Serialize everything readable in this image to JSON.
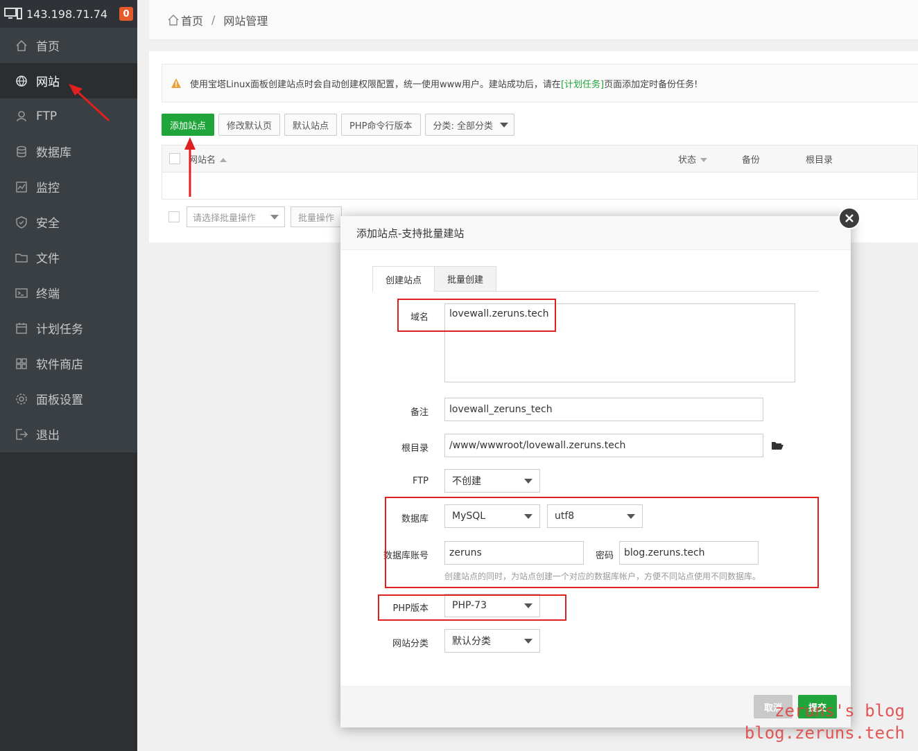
{
  "sidebar": {
    "server_ip": "143.198.71.74",
    "badge": "0",
    "items": [
      {
        "label": "首页",
        "icon": "home-icon"
      },
      {
        "label": "网站",
        "icon": "globe-icon"
      },
      {
        "label": "FTP",
        "icon": "ftp-icon"
      },
      {
        "label": "数据库",
        "icon": "database-icon"
      },
      {
        "label": "监控",
        "icon": "monitor-icon"
      },
      {
        "label": "安全",
        "icon": "shield-icon"
      },
      {
        "label": "文件",
        "icon": "folder-icon"
      },
      {
        "label": "终端",
        "icon": "terminal-icon"
      },
      {
        "label": "计划任务",
        "icon": "calendar-icon"
      },
      {
        "label": "软件商店",
        "icon": "apps-icon"
      },
      {
        "label": "面板设置",
        "icon": "gear-icon"
      },
      {
        "label": "退出",
        "icon": "logout-icon"
      }
    ],
    "active_index": 1
  },
  "breadcrumb": {
    "home": "首页",
    "sep": "/",
    "current": "网站管理"
  },
  "alert": {
    "text_before": "使用宝塔Linux面板创建站点时会自动创建权限配置，统一使用www用户。建站成功后，请在",
    "link": "[计划任务]",
    "text_after": "页面添加定时备份任务!"
  },
  "toolbar": {
    "add_site": "添加站点",
    "modify_default_page": "修改默认页",
    "default_site": "默认站点",
    "php_cli_version": "PHP命令行版本",
    "category": "分类: 全部分类"
  },
  "table": {
    "headers": {
      "name": "网站名",
      "status": "状态",
      "backup": "备份",
      "root": "根目录"
    }
  },
  "batch": {
    "placeholder": "请选择批量操作",
    "button": "批量操作"
  },
  "modal": {
    "title": "添加站点-支持批量建站",
    "tabs": [
      "创建站点",
      "批量创建"
    ],
    "fields": {
      "domain_label": "域名",
      "domain_value": "lovewall.zeruns.tech",
      "remark_label": "备注",
      "remark_value": "lovewall_zeruns_tech",
      "root_label": "根目录",
      "root_value": "/www/wwwroot/lovewall.zeruns.tech",
      "ftp_label": "FTP",
      "ftp_value": "不创建",
      "db_label": "数据库",
      "db_type": "MySQL",
      "db_charset": "utf8",
      "db_user_label": "数据库账号",
      "db_user_value": "zeruns",
      "db_pass_label": "密码",
      "db_pass_value": "blog.zeruns.tech",
      "db_hint": "创建站点的同时，为站点创建一个对应的数据库帐户，方便不同站点使用不同数据库。",
      "php_label": "PHP版本",
      "php_value": "PHP-73",
      "category_label": "网站分类",
      "category_value": "默认分类"
    },
    "buttons": {
      "cancel": "取消",
      "submit": "提交"
    }
  },
  "watermark": {
    "line1": "zeruns's blog",
    "line2": "blog.zeruns.tech"
  },
  "colors": {
    "accent": "#20a53a",
    "sidebar": "#3a3f44",
    "annotation": "#e02020"
  }
}
